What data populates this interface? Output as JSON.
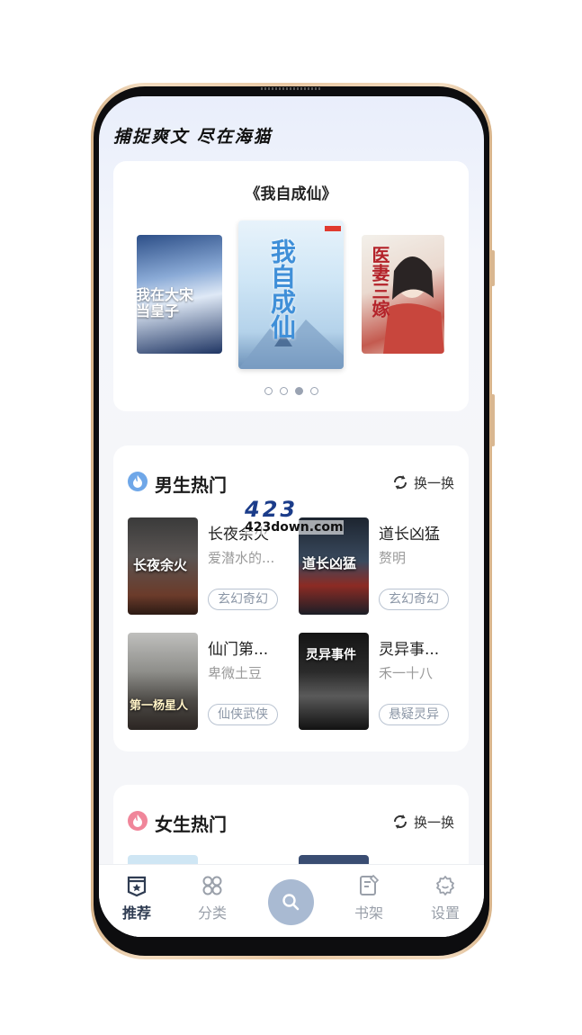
{
  "header": {
    "slogan": "捕捉爽文 尽在海猫"
  },
  "banner": {
    "title": "《我自成仙》",
    "covers": [
      {
        "name": "cover-left",
        "text": "我在大宋当皇子"
      },
      {
        "name": "cover-center",
        "text": "我自成仙"
      },
      {
        "name": "cover-right",
        "text": "医妻三嫁"
      }
    ],
    "dots": 4,
    "active_dot": 3
  },
  "male_section": {
    "title": "男生热门",
    "refresh_label": "换一换",
    "books": [
      {
        "title": "长夜余火",
        "author": "爱潜水的...",
        "tag": "玄幻奇幻",
        "cover_word": "长夜余火"
      },
      {
        "title": "道长凶猛",
        "author": "赘明",
        "tag": "玄幻奇幻",
        "cover_word": "道长凶猛"
      },
      {
        "title": "仙门第...",
        "author": "卑微土豆",
        "tag": "仙侠武侠",
        "cover_word": "第一杨星人"
      },
      {
        "title": "灵异事...",
        "author": "禾一十八",
        "tag": "悬疑灵异",
        "cover_word": "灵异事件"
      }
    ]
  },
  "female_section": {
    "title": "女生热门",
    "refresh_label": "换一换"
  },
  "tabbar": {
    "tabs": [
      {
        "label": "推荐",
        "icon": "recommend-icon",
        "active": true
      },
      {
        "label": "分类",
        "icon": "category-icon",
        "active": false
      },
      {
        "label": "书架",
        "icon": "bookshelf-icon",
        "active": false
      },
      {
        "label": "设置",
        "icon": "settings-icon",
        "active": false
      }
    ],
    "search_icon": "search-icon"
  },
  "watermark": {
    "big": "423",
    "small": "423down.com"
  },
  "colors": {
    "accent": "#2f3c52",
    "fab": "#a9bad2",
    "male_icon": "#4a90e2",
    "female_icon": "#f0708a"
  }
}
